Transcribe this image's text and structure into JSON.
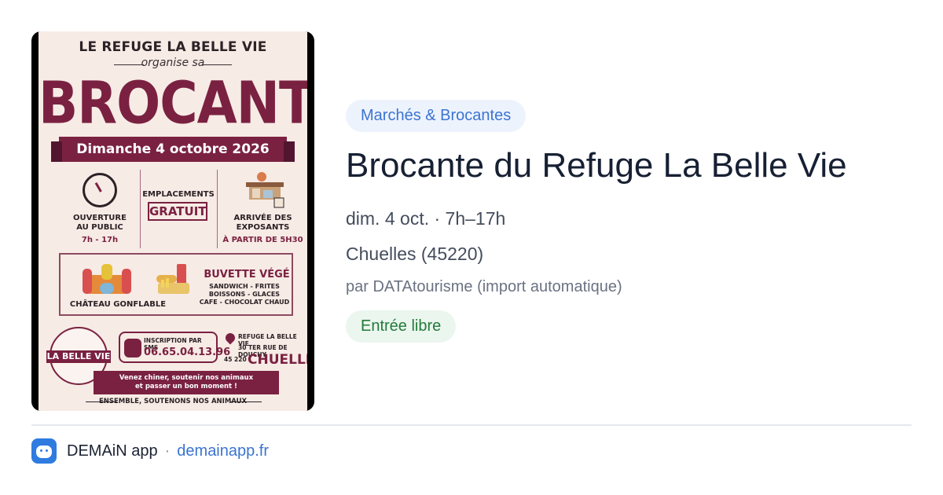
{
  "poster": {
    "org_title": "LE REFUGE LA BELLE VIE",
    "org_sub": "organise sa",
    "headline": "BROCANTE",
    "date_ribbon": "Dimanche 4 octobre 2026",
    "col1_line1": "OUVERTURE",
    "col1_line2": "AU PUBLIC",
    "col1_hours": "7h - 17h",
    "col2_label": "EMPLACEMENTS",
    "col2_value": "GRATUIT",
    "col3_line1": "ARRIVÉE DES",
    "col3_line2": "EXPOSANTS",
    "col3_time": "À PARTIR DE 5H30",
    "castle_label": "CHÂTEAU GONFLABLE",
    "buvette_title": "BUVETTE VÉGÉ",
    "buvette_l1": "SANDWICH - FRITES",
    "buvette_l2": "BOISSONS - GLACES",
    "buvette_l3": "CAFE - CHOCOLAT CHAUD",
    "logo_text": "LA BELLE VIE",
    "sms_label": "INSCRIPTION PAR SMS",
    "sms_phone": "06.65.04.13.96",
    "addr_name": "REFUGE LA BELLE VIE",
    "addr_street": "30 TER RUE DE DOUCHY",
    "addr_zip": "45 220",
    "addr_city": "CHUELLES",
    "ribbon_l1": "Venez chiner, soutenir nos animaux",
    "ribbon_l2": "et passer un bon moment !",
    "footer": "ENSEMBLE, SOUTENONS NOS ANIMAUX"
  },
  "event": {
    "category": "Marchés & Brocantes",
    "title": "Brocante du Refuge La Belle Vie",
    "datetime": "dim. 4 oct. · 7h–17h",
    "location": "Chuelles (45220)",
    "organizer": "par DATAtourisme (import automatique)",
    "entry": "Entrée libre"
  },
  "footer": {
    "app_name": "DEMAiN app",
    "separator": "·",
    "url": "demainapp.fr"
  },
  "colors": {
    "accent_blue": "#3b74d1",
    "chip_blue_bg": "#edf3fd",
    "chip_green_bg": "#ebf6ee",
    "chip_green_text": "#237a3b",
    "poster_burgundy": "#7a2141"
  }
}
